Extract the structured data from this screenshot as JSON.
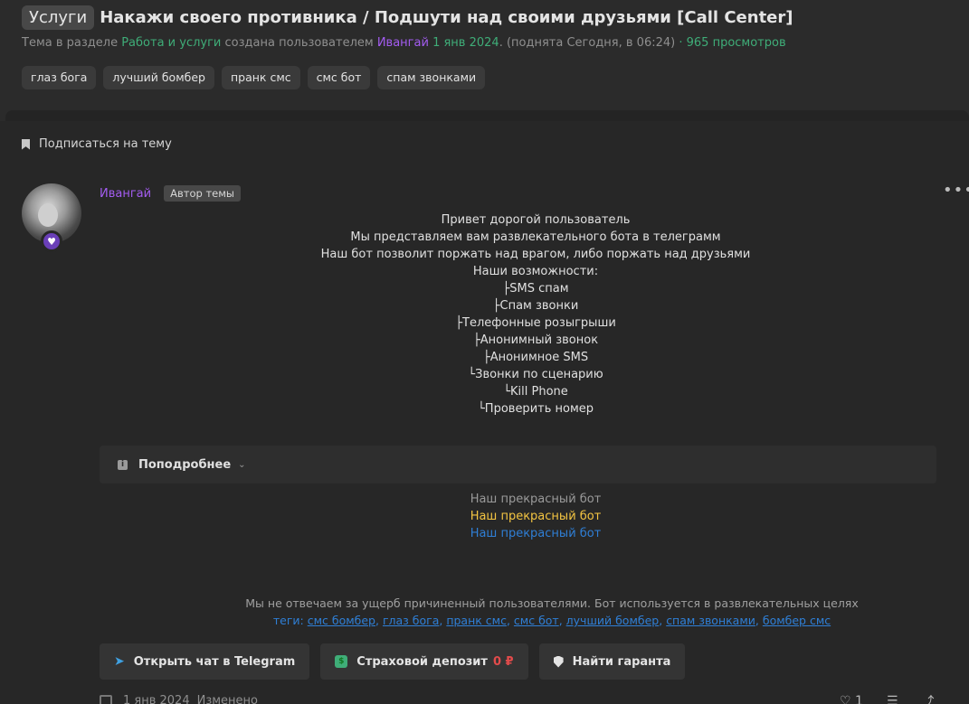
{
  "header": {
    "prefix": "Услуги",
    "title": "Накажи своего противника / Подшути над своими друзьями [Call Center]",
    "meta": {
      "t1": "Тема в разделе",
      "section": "Работа и услуги",
      "t2": "создана пользователем",
      "author": "Ивангай",
      "date": "1 янв 2024",
      "raised": ". (поднята Сегодня, в 06:24)",
      "views": "· 965 просмотров"
    },
    "tags": [
      "глаз бога",
      "лучший бомбер",
      "пранк смс",
      "смс бот",
      "спам звонками"
    ]
  },
  "subscribe": {
    "label": "Подписаться на тему"
  },
  "post": {
    "author": "Ивангай",
    "badge": "Автор темы",
    "more": "•••",
    "lines": [
      "Привет дорогой пользователь",
      "Мы представляем вам развлекательного бота в телеграмм",
      "Наш бот позволит поржать над врагом, либо поржать над друзьями",
      "Наши возможности:",
      "├SMS спам",
      "├Спам звонки",
      "├Телефонные розыгрыши",
      "├Анонимный звонок",
      "├Анонимное SMS",
      "└Звонки по сценарию",
      "└Kill Phone",
      "└Проверить номер"
    ],
    "spoiler": {
      "label": "Поподробнее"
    },
    "nice": [
      "Наш прекрасный бот",
      "Наш прекрасный бот",
      "Наш прекрасный бот"
    ],
    "disclaimer": "Мы не отвечаем за ущерб причиненный пользователями. Бот используется в развлекательных целях",
    "tags_prefix": "теги:",
    "tag_links": [
      "смс бомбер",
      "глаз бога",
      "пранк смс",
      "смс бот",
      "лучший бомбер",
      "спам звонками",
      "бомбер смс"
    ],
    "buttons": {
      "telegram": "Открыть чат в Telegram",
      "deposit": "Страховой депозит",
      "deposit_value": "0 ₽",
      "guarantor": "Найти гаранта"
    },
    "footer": {
      "date": "1 янв 2024",
      "edited": "Изменено",
      "likes": "1"
    }
  },
  "colors": {
    "accent_green": "#3fad78",
    "author_purple": "#a35cf0",
    "link_blue": "#2f7fd6",
    "gold": "#f4c542"
  }
}
